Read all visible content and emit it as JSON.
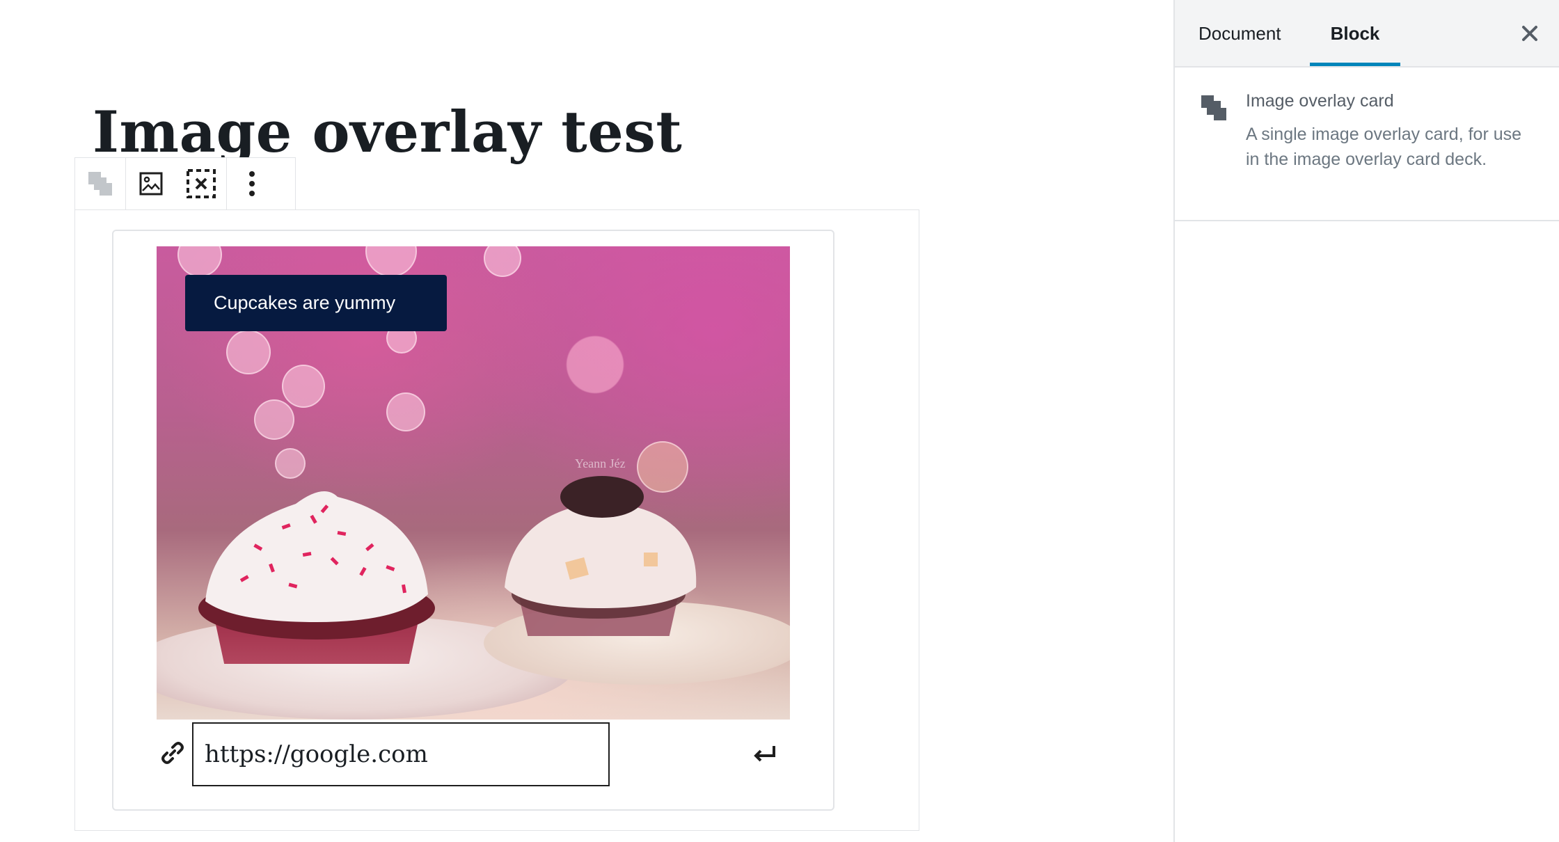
{
  "post": {
    "title": "Image overlay test"
  },
  "toolbar": {
    "icons": [
      "block-type-icon",
      "replace-image-icon",
      "remove-image-icon",
      "more-options-icon"
    ]
  },
  "card": {
    "overlay_text": "Cupcakes are yummy",
    "watermark": "Yeann Jéz",
    "url_value": "https://google.com"
  },
  "sidebar": {
    "tabs": [
      {
        "label": "Document"
      },
      {
        "label": "Block"
      }
    ],
    "active_tab": "Block",
    "block": {
      "title": "Image overlay card",
      "description": "A single image overlay card, for use in the image overlay card deck."
    }
  },
  "colors": {
    "overlay_bg": "#061a40",
    "tab_accent": "#0085ba",
    "border": "#e2e4e7",
    "sidebar_header": "#f3f4f5"
  }
}
